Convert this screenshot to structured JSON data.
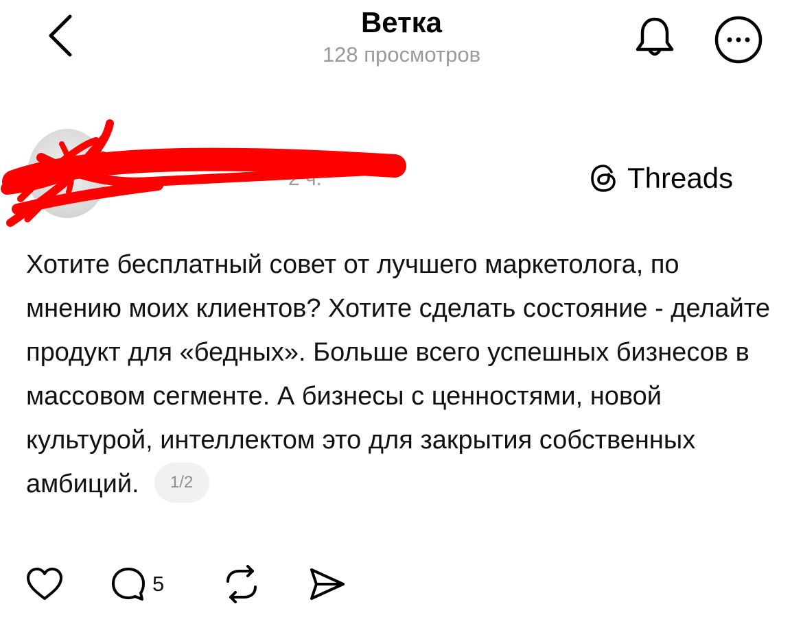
{
  "header": {
    "title": "Ветка",
    "subtitle": "128 просмотров"
  },
  "icons": {
    "back": "back-chevron-icon",
    "bell": "bell-icon",
    "more": "more-options-icon",
    "threads": "threads-logo-icon",
    "like": "heart-icon",
    "reply": "comment-icon",
    "repost": "repost-icon",
    "share": "send-icon"
  },
  "author": {
    "meta": "2 ч."
  },
  "source": {
    "label": "Threads"
  },
  "post": {
    "text": "Хотите бесплатный совет от лучшего маркетолога, по мнению моих клиентов? Хотите сделать состояние - делайте продукт для «бедных». Больше всего успешных бизнесов в массовом сегменте. А бизнесы с ценностями, новой культурой, интеллектом это для закрытия собственных амбиций.",
    "page_indicator": "1/2"
  },
  "actions": {
    "reply_count": "5"
  },
  "colors": {
    "scribble": "#ff0000",
    "muted_text": "#9a9a9a",
    "pill_bg": "#f1f1f1"
  }
}
